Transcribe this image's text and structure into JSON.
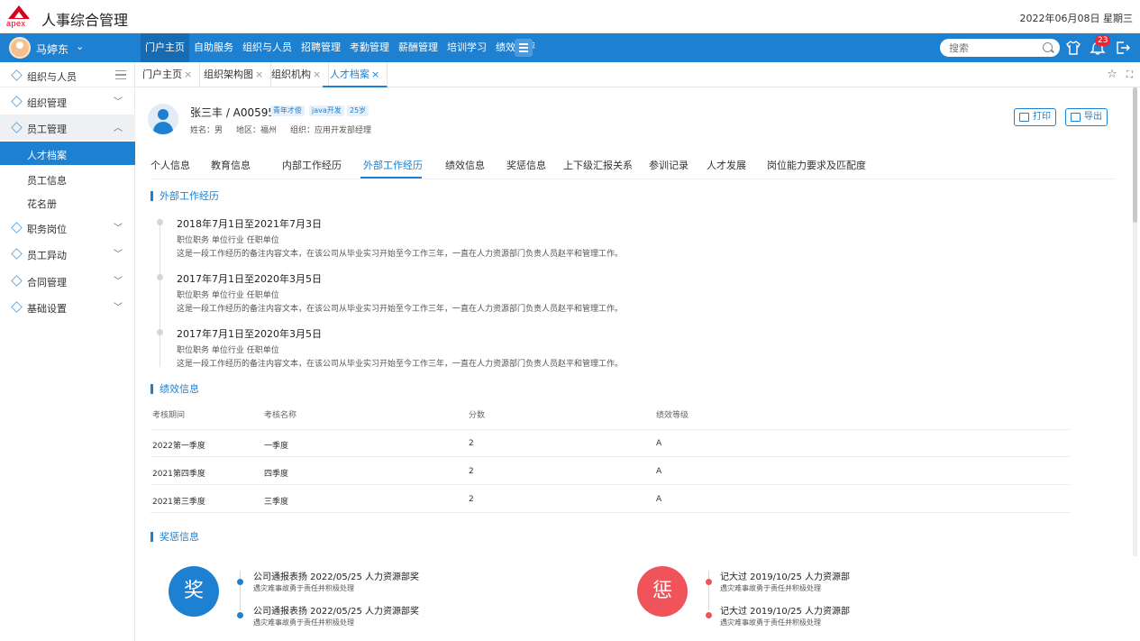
{
  "app": {
    "logo_text": "apex",
    "title": "人事综合管理",
    "date": "2022年06月08日 星期三"
  },
  "user": {
    "name": "马婷东"
  },
  "nav": {
    "items": [
      "门户主页",
      "自助服务",
      "组织与人员",
      "招聘管理",
      "考勤管理",
      "薪酬管理",
      "培训学习",
      "绩效考评"
    ],
    "search_placeholder": "搜索",
    "notification_count": "23"
  },
  "sidebar": {
    "header": "组织与人员",
    "items": [
      {
        "label": "组织管理"
      },
      {
        "label": "员工管理"
      },
      {
        "label": "人才档案"
      },
      {
        "label": "员工信息"
      },
      {
        "label": "花名册"
      },
      {
        "label": "职务岗位"
      },
      {
        "label": "员工异动"
      },
      {
        "label": "合同管理"
      },
      {
        "label": "基础设置"
      }
    ]
  },
  "tabs": [
    {
      "label": "门户主页"
    },
    {
      "label": "组织架构图"
    },
    {
      "label": "组织机构"
    },
    {
      "label": "人才档案"
    }
  ],
  "profile": {
    "name_id": "张三丰 / A00595",
    "tags": [
      "青年才俊",
      "java开发",
      "25岁"
    ],
    "gender": "姓名：男",
    "region": "地区：福州",
    "org": "组织：应用开发部经理",
    "print_label": "打印",
    "export_label": "导出"
  },
  "subtabs": [
    "个人信息",
    "教育信息",
    "内部工作经历",
    "外部工作经历",
    "绩效信息",
    "奖惩信息",
    "上下级汇报关系",
    "参训记录",
    "人才发展",
    "岗位能力要求及匹配度"
  ],
  "sections": {
    "external": "外部工作经历",
    "performance": "绩效信息",
    "awards": "奖惩信息"
  },
  "timeline": [
    {
      "date": "2018年7月1日至2021年7月3日",
      "meta": "职位职务   单位行业   任职单位",
      "desc": "这是一段工作经历的备注内容文本，在该公司从毕业实习开始至今工作三年，一直在人力资源部门负责人员赵平和管理工作。"
    },
    {
      "date": "2017年7月1日至2020年3月5日",
      "meta": "职位职务   单位行业   任职单位",
      "desc": "这是一段工作经历的备注内容文本，在该公司从毕业实习开始至今工作三年，一直在人力资源部门负责人员赵平和管理工作。"
    },
    {
      "date": "2017年7月1日至2020年3月5日",
      "meta": "职位职务   单位行业   任职单位",
      "desc": "这是一段工作经历的备注内容文本，在该公司从毕业实习开始至今工作三年，一直在人力资源部门负责人员赵平和管理工作。"
    }
  ],
  "performance": {
    "headers": [
      "考核期间",
      "考核名称",
      "分数",
      "绩效等级"
    ],
    "rows": [
      [
        "2022第一季度",
        "一季度",
        "2",
        "A"
      ],
      [
        "2021第四季度",
        "四季度",
        "2",
        "A"
      ],
      [
        "2021第三季度",
        "三季度",
        "2",
        "A"
      ]
    ]
  },
  "awards": {
    "reward_char": "奖",
    "punish_char": "惩",
    "reward_color": "#1e80d0",
    "punish_color": "#f0545a",
    "rewards": [
      {
        "title": "公司通报表扬  2022/05/25  人力资源部奖",
        "sub": "遇灾难事故勇于责任并积极处理"
      },
      {
        "title": "公司通报表扬  2022/05/25  人力资源部奖",
        "sub": "遇灾难事故勇于责任并积极处理"
      }
    ],
    "punishments": [
      {
        "title": "记大过  2019/10/25  人力资源部",
        "sub": "遇灾难事故勇于责任并积极处理"
      },
      {
        "title": "记大过  2019/10/25  人力资源部",
        "sub": "遇灾难事故勇于责任并积极处理"
      }
    ]
  }
}
